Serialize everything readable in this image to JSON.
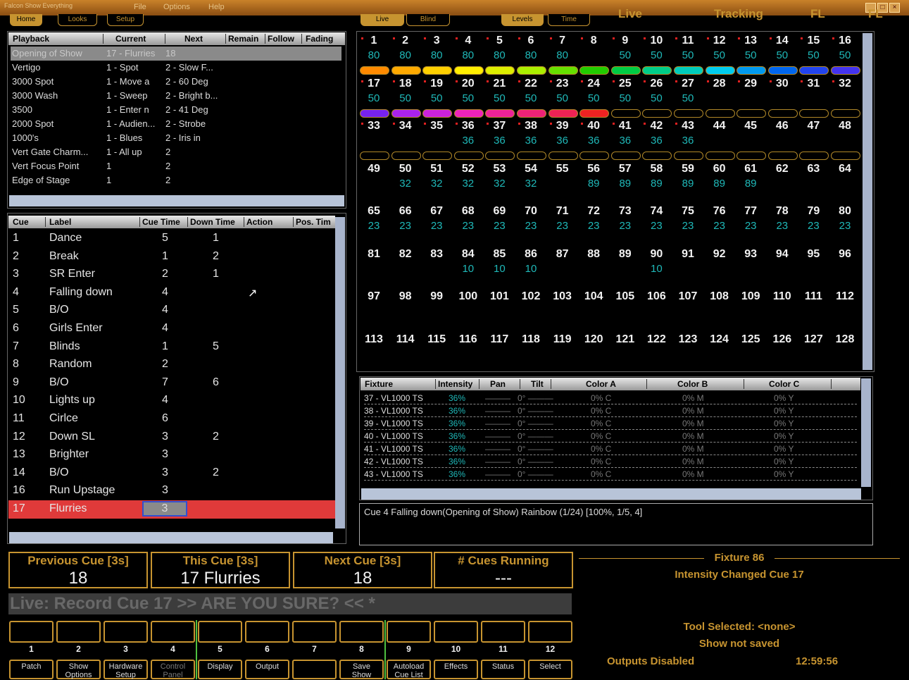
{
  "window": {
    "title": "Falcon Show Everything",
    "menu": [
      "File",
      "Options",
      "Help"
    ]
  },
  "toolbar": {
    "left_tabs": [
      "Home",
      "Looks",
      "Setup"
    ],
    "grid_tabs": [
      "Live",
      "Blind"
    ],
    "mid_tabs": [
      "Levels",
      "Time"
    ],
    "big_tabs": [
      "Live",
      "Tracking",
      "FL",
      "FL"
    ]
  },
  "playback": {
    "headers": [
      "Playback",
      "Current",
      "Next",
      "Remain",
      "Follow",
      "Fading"
    ],
    "rows": [
      {
        "name": "Opening of Show",
        "current": "17 - Flurries",
        "next": "18",
        "selected": true
      },
      {
        "name": "Vertigo",
        "current": "1 - Spot",
        "next": "2 - Slow F..."
      },
      {
        "name": "3000 Spot",
        "current": "1 - Move a",
        "next": "2 - 60 Deg"
      },
      {
        "name": "3000 Wash",
        "current": "1 - Sweep",
        "next": "2 - Bright b..."
      },
      {
        "name": "3500",
        "current": "1 - Enter n",
        "next": "2 - 41 Deg"
      },
      {
        "name": "2000 Spot",
        "current": "1 - Audien...",
        "next": "2 - Strobe"
      },
      {
        "name": "1000's",
        "current": "1 - Blues",
        "next": "2 - Iris in"
      },
      {
        "name": "Vert Gate Charm...",
        "current": "1 - All up",
        "next": "2"
      },
      {
        "name": "Vert Focus Point",
        "current": "1",
        "next": "2"
      },
      {
        "name": "Edge of Stage",
        "current": "1",
        "next": "2"
      }
    ]
  },
  "cues": {
    "headers": [
      "Cue",
      "Label",
      "Cue Time",
      "Down Time",
      "Action",
      "Pos. Tim"
    ],
    "rows": [
      {
        "cue": "1",
        "label": "Dance",
        "time": "5",
        "down": "1",
        "action": ""
      },
      {
        "cue": "2",
        "label": "Break",
        "time": "1",
        "down": "2",
        "action": ""
      },
      {
        "cue": "3",
        "label": "SR Enter",
        "time": "2",
        "down": "1",
        "action": ""
      },
      {
        "cue": "4",
        "label": "Falling down",
        "time": "4",
        "down": "",
        "action": "↗"
      },
      {
        "cue": "5",
        "label": "B/O",
        "time": "4",
        "down": "",
        "action": ""
      },
      {
        "cue": "6",
        "label": "Girls Enter",
        "time": "4",
        "down": "",
        "action": ""
      },
      {
        "cue": "7",
        "label": "Blinds",
        "time": "1",
        "down": "5",
        "action": ""
      },
      {
        "cue": "8",
        "label": "Random",
        "time": "2",
        "down": "",
        "action": ""
      },
      {
        "cue": "9",
        "label": "B/O",
        "time": "7",
        "down": "6",
        "action": ""
      },
      {
        "cue": "10",
        "label": "Lights up",
        "time": "4",
        "down": "",
        "action": ""
      },
      {
        "cue": "11",
        "label": "Cirlce",
        "time": "6",
        "down": "",
        "action": ""
      },
      {
        "cue": "12",
        "label": "Down SL",
        "time": "3",
        "down": "2",
        "action": ""
      },
      {
        "cue": "13",
        "label": "Brighter",
        "time": "3",
        "down": "",
        "action": ""
      },
      {
        "cue": "14",
        "label": "B/O",
        "time": "3",
        "down": "2",
        "action": ""
      },
      {
        "cue": "16",
        "label": "Run Upstage",
        "time": "3",
        "down": "",
        "action": ""
      },
      {
        "cue": "17",
        "label": "Flurries",
        "time": "3",
        "down": "",
        "action": "",
        "selected": true
      }
    ]
  },
  "channels": {
    "values": {
      "1": "80",
      "2": "80",
      "3": "80",
      "4": "80",
      "5": "80",
      "6": "80",
      "7": "80",
      "9": "50",
      "10": "50",
      "11": "50",
      "12": "50",
      "13": "50",
      "14": "50",
      "15": "50",
      "16": "50",
      "17": "50",
      "18": "50",
      "19": "50",
      "20": "50",
      "21": "50",
      "22": "50",
      "23": "50",
      "24": "50",
      "25": "50",
      "26": "50",
      "27": "50",
      "36": "36",
      "37": "36",
      "38": "36",
      "39": "36",
      "40": "36",
      "41": "36",
      "42": "36",
      "43": "36",
      "50": "32",
      "51": "32",
      "52": "32",
      "53": "32",
      "54": "32",
      "56": "89",
      "57": "89",
      "58": "89",
      "59": "89",
      "60": "89",
      "61": "89",
      "65": "23",
      "66": "23",
      "67": "23",
      "68": "23",
      "69": "23",
      "70": "23",
      "71": "23",
      "72": "23",
      "73": "23",
      "74": "23",
      "75": "23",
      "76": "23",
      "77": "23",
      "78": "23",
      "79": "23",
      "80": "23",
      "84": "10",
      "85": "10",
      "86": "10",
      "90": "10"
    },
    "dotted": [
      1,
      2,
      3,
      4,
      5,
      6,
      7,
      8,
      9,
      10,
      11,
      12,
      13,
      14,
      15,
      16,
      17,
      18,
      19,
      20,
      21,
      22,
      23,
      24,
      25,
      26,
      27,
      28,
      29,
      30,
      31,
      32,
      33,
      34,
      35,
      36,
      37,
      38,
      39,
      40,
      41,
      42,
      43
    ],
    "swatch_rows": [
      [
        "#ff8a00",
        "#ffaa00",
        "#ffd000",
        "#ffee00",
        "#ddee00",
        "#aaee00",
        "#66e000",
        "#22cc00",
        "#00cc44",
        "#00cc88",
        "#00ccbb",
        "#00ccee",
        "#0099ee",
        "#0066ee",
        "#2244ee",
        "#4433ee"
      ],
      [
        "#7722ee",
        "#aa22ee",
        "#cc22dd",
        "#ee22bb",
        "#ee2299",
        "#ee2277",
        "#ee2255",
        "#ee2222",
        "",
        "",
        "",
        "",
        "",
        "",
        "",
        ""
      ],
      [
        "",
        "",
        "",
        "",
        "",
        "",
        "",
        "",
        "",
        "",
        "",
        "",
        "",
        "",
        "",
        ""
      ]
    ]
  },
  "fixtures": {
    "headers": [
      "Fixture",
      "Intensity",
      "Pan",
      "Tilt",
      "Color A",
      "Color B",
      "Color C"
    ],
    "rows": [
      {
        "fixture": "37 - VL1000 TS",
        "intensity": "36%",
        "pan": "———",
        "tilt": "0° ———",
        "ca": "0% C",
        "cb": "0% M",
        "cc": "0% Y"
      },
      {
        "fixture": "38 - VL1000 TS",
        "intensity": "36%",
        "pan": "———",
        "tilt": "0° ———",
        "ca": "0% C",
        "cb": "0% M",
        "cc": "0% Y"
      },
      {
        "fixture": "39 - VL1000 TS",
        "intensity": "36%",
        "pan": "———",
        "tilt": "0° ———",
        "ca": "0% C",
        "cb": "0% M",
        "cc": "0% Y"
      },
      {
        "fixture": "40 - VL1000 TS",
        "intensity": "36%",
        "pan": "———",
        "tilt": "0° ———",
        "ca": "0% C",
        "cb": "0% M",
        "cc": "0% Y"
      },
      {
        "fixture": "41 - VL1000 TS",
        "intensity": "36%",
        "pan": "———",
        "tilt": "0° ———",
        "ca": "0% C",
        "cb": "0% M",
        "cc": "0% Y"
      },
      {
        "fixture": "42 - VL1000 TS",
        "intensity": "36%",
        "pan": "———",
        "tilt": "0° ———",
        "ca": "0% C",
        "cb": "0% M",
        "cc": "0% Y"
      },
      {
        "fixture": "43 - VL1000 TS",
        "intensity": "36%",
        "pan": "———",
        "tilt": "0° ———",
        "ca": "0% C",
        "cb": "0% M",
        "cc": "0% Y"
      }
    ]
  },
  "info_line": "Cue 4 Falling down(Opening of Show) Rainbow (1/24) [100%, 1/5, 4]",
  "cue_status": {
    "previous": {
      "label": "Previous Cue [3s]",
      "value": "18"
    },
    "this": {
      "label": "This Cue [3s]",
      "value": "17 Flurries"
    },
    "next": {
      "label": "Next Cue [3s]",
      "value": "18"
    },
    "running": {
      "label": "# Cues Running",
      "value": "---"
    }
  },
  "command_line": "Live: Record Cue 17 >> ARE YOU SURE? << *",
  "fixture_info": {
    "title": "Fixture 86",
    "subtitle": "Intensity Changed Cue 17"
  },
  "status": {
    "tool": "Tool Selected: <none>",
    "show": "Show not saved",
    "outputs": "Outputs Disabled",
    "time": "12:59:56"
  },
  "fkeys": {
    "numbers": [
      "1",
      "2",
      "3",
      "4",
      "5",
      "6",
      "7",
      "8",
      "9",
      "10",
      "11",
      "12"
    ],
    "labels": [
      "Patch",
      "Show\nOptions",
      "Hardware\nSetup",
      "Control\nPanel",
      "Display",
      "Output",
      "",
      "Save\nShow",
      "Autoload\nCue List",
      "Effects",
      "Status",
      "Select"
    ],
    "disabled": [
      3
    ]
  },
  "colors": {
    "accent": "#c79430",
    "teal": "#1fb8b8",
    "selected_row": "#e03a3a"
  }
}
